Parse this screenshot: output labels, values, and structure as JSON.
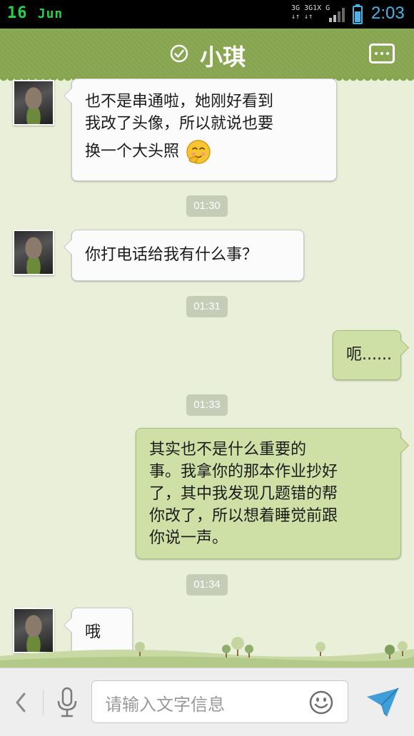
{
  "status_bar": {
    "date_day": "16",
    "date_month": "Jun",
    "network_top": "3G 3G1X G",
    "network_bottom": "↓↑ ↓↑",
    "time": "2:03",
    "battery_icon": "battery-icon",
    "signal_icon": "signal-icon"
  },
  "header": {
    "title": "小琪",
    "status_icon": "check-circle-icon",
    "menu_icon": "chat-menu-icon"
  },
  "messages": [
    {
      "side": "left",
      "line1": "也不是串通啦，她刚好看到",
      "line2": "我改了头像，所以就说也要",
      "line3": "换一个大头照",
      "emoji": "shy-smile-emoji"
    },
    {
      "side": "left",
      "text": "你打电话给我有什么事？"
    },
    {
      "side": "right",
      "text": "呃......"
    },
    {
      "side": "right",
      "line1": "其实也不是什么重要的",
      "line2": "事。我拿你的那本作业抄好",
      "line3": "了，其中我发现几题错的帮",
      "line4": "你改了，所以想着睡觉前跟",
      "line5": "你说一声。"
    },
    {
      "side": "left",
      "text": "哦"
    }
  ],
  "timestamps": [
    "01:30",
    "01:31",
    "01:33",
    "01:34"
  ],
  "input_bar": {
    "placeholder": "请输入文字信息",
    "back_icon": "chevron-left-icon",
    "voice_icon": "microphone-icon",
    "emoji_icon": "smiley-icon",
    "send_icon": "send-arrow-icon"
  },
  "colors": {
    "header": "#87a44f",
    "chat_background": "#e9efd9",
    "right_bubble": "#cfe0a6",
    "left_bubble": "#fbfbfb",
    "time_accent": "#46b4e6",
    "date_accent": "#21d24a"
  }
}
